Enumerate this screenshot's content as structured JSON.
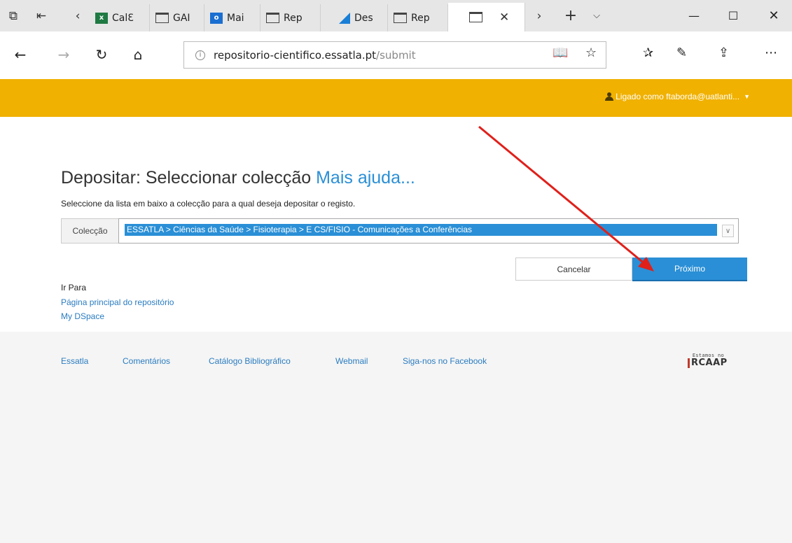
{
  "browser": {
    "tabs": [
      {
        "label": "CalƐ",
        "icon": "excel-icon"
      },
      {
        "label": "GAI",
        "icon": "page-icon"
      },
      {
        "label": "Mai",
        "icon": "outlook-icon"
      },
      {
        "label": "Rep",
        "icon": "page-icon"
      },
      {
        "label": "Des",
        "icon": "dev-icon"
      },
      {
        "label": "Rep",
        "icon": "page-icon"
      },
      {
        "label": "",
        "icon": "page-icon"
      }
    ],
    "url_host": "repositorio-cientifico.essatla.pt",
    "url_path": "/submit"
  },
  "header": {
    "user_label": "Ligado como ftaborda@uatlanti..."
  },
  "main": {
    "title": "Depositar: Seleccionar colecção",
    "help_link": "Mais ajuda...",
    "description": "Seleccione da lista em baixo a colecção para a qual deseja depositar o registo.",
    "collection_label": "Colecção",
    "collection_value": "ESSATLA > Ciências da Saúde > Fisioterapia > E CS/FISIO - Comunicações a Conferências",
    "cancel_label": "Cancelar",
    "next_label": "Próximo",
    "goto_title": "Ir Para",
    "goto_links": [
      "Página principal do repositório",
      "My DSpace"
    ]
  },
  "footer": {
    "links": [
      "Essatla",
      "Comentários",
      "Catálogo Bibliográfico",
      "Webmail",
      "Siga-nos no Facebook"
    ],
    "rcaap_small": "Estamos no",
    "rcaap_big": "RCAAP"
  },
  "colors": {
    "accent_bar": "#f0b100",
    "primary": "#2a8fd6",
    "annotation_arrow": "#e0201a"
  }
}
